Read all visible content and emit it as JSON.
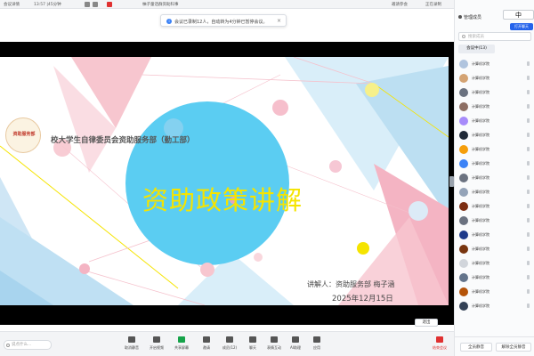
{
  "topbar": {
    "app": "会议详情",
    "time": "13:57 |45分钟",
    "meeting_title": "柚子童话群资助科事",
    "right_label": "邀请参会",
    "live_label": "正在录制",
    "speaker_label": "正在讲话: 贵"
  },
  "notice": {
    "text": "会议已录制12人，自动转为4分钟已暂停会议。",
    "close": "×"
  },
  "slide": {
    "logo_text": "资助服务部",
    "org_title": "校大学生自律委员会资助服务部（勤工部）",
    "title": "资助政策讲解",
    "speaker": "讲解人：资助服务部 梅子涵",
    "date": "2025年12月15日"
  },
  "float_chip": "退出",
  "chat_input": {
    "placeholder": "说点什么..."
  },
  "toolbar": {
    "items": [
      {
        "label": "取消静音"
      },
      {
        "label": "开启视频"
      },
      {
        "label": "共享屏幕"
      },
      {
        "label": "邀请"
      },
      {
        "label": "成员(12)"
      },
      {
        "label": "聊天"
      },
      {
        "label": "表情互动"
      },
      {
        "label": "AI助理"
      },
      {
        "label": "应用"
      }
    ],
    "leave_label": "结束会议"
  },
  "sidebar": {
    "title": "管理成员",
    "ime": "中",
    "button": "打开聊天",
    "search_placeholder": "搜索成员",
    "tabs": [
      "会议中(13)",
      ""
    ],
    "participants": [
      {
        "name": "计算机学院",
        "color": "#b0c4de"
      },
      {
        "name": "计算机学院",
        "color": "#d4a373"
      },
      {
        "name": "计算机学院",
        "color": "#6b7280"
      },
      {
        "name": "计算机学院",
        "color": "#8d6e63"
      },
      {
        "name": "计算机学院",
        "color": "#a78bfa"
      },
      {
        "name": "计算机学院",
        "color": "#1f2937"
      },
      {
        "name": "计算机学院",
        "color": "#f59e0b"
      },
      {
        "name": "计算机学院",
        "color": "#3b82f6"
      },
      {
        "name": "计算机学院",
        "color": "#6b7280"
      },
      {
        "name": "计算机学院",
        "color": "#94a3b8"
      },
      {
        "name": "计算机学院",
        "color": "#7c2d12"
      },
      {
        "name": "计算机学院",
        "color": "#6b7280"
      },
      {
        "name": "计算机学院",
        "color": "#1e3a8a"
      },
      {
        "name": "计算机学院",
        "color": "#78350f"
      },
      {
        "name": "计算机学院",
        "color": "#d1d5db"
      },
      {
        "name": "计算机学院",
        "color": "#64748b"
      },
      {
        "name": "计算机学院",
        "color": "#b45309"
      },
      {
        "name": "计算机学院",
        "color": "#334155"
      }
    ],
    "bottom_left": "全员静音",
    "bottom_right": "解除全员静音"
  }
}
